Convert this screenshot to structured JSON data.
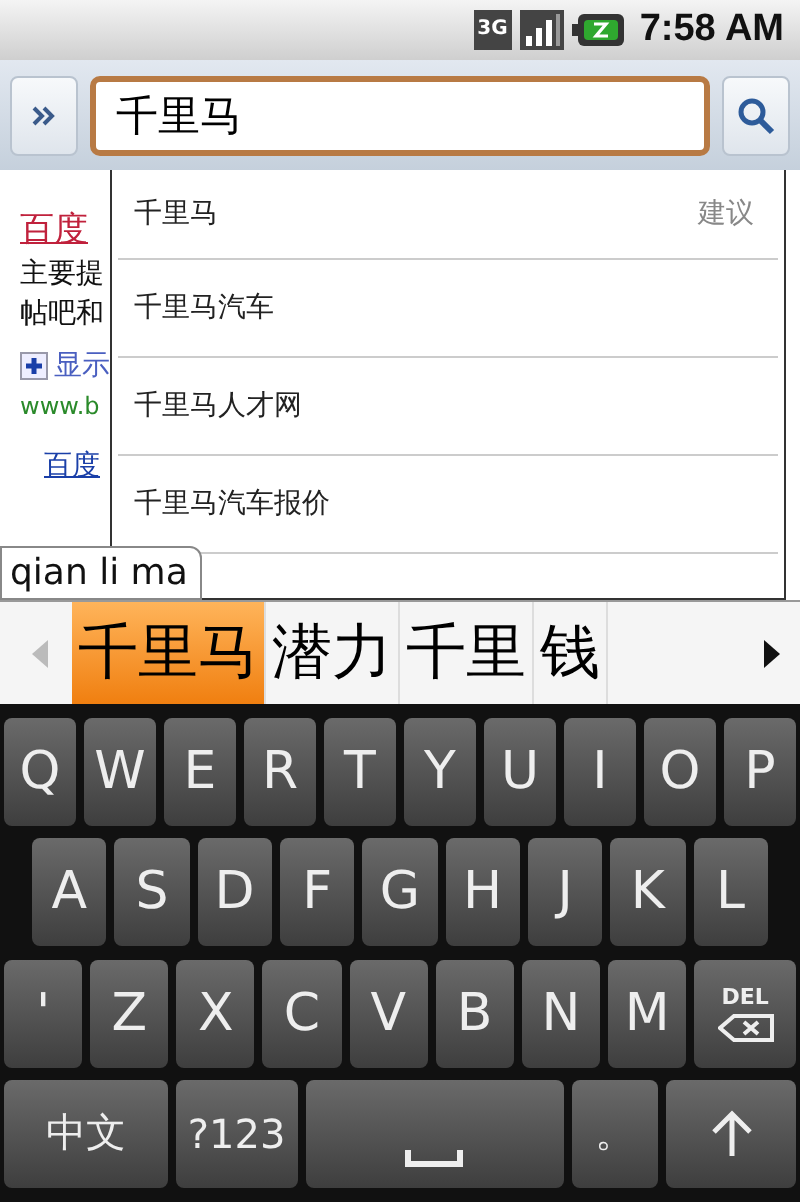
{
  "status_bar": {
    "network": "3G",
    "time": "7:58 AM"
  },
  "toolbar": {
    "query": "千里马"
  },
  "page": {
    "title": "百度",
    "lines": [
      "主要提",
      "帖吧和"
    ],
    "expand_link": "显示",
    "url": "www.b",
    "sub_link": "百度"
  },
  "suggestions": [
    {
      "text": "千里马",
      "tag": "建议"
    },
    {
      "text": "千里马汽车"
    },
    {
      "text": "千里马人才网"
    },
    {
      "text": "千里马汽车报价"
    }
  ],
  "composing": "qian li ma",
  "candidates": [
    {
      "text": "千里马",
      "selected": true
    },
    {
      "text": "潜力",
      "selected": false
    },
    {
      "text": "千里",
      "selected": false
    },
    {
      "text": "钱",
      "selected": false
    }
  ],
  "keyboard": {
    "rows": [
      [
        {
          "kind": "char",
          "label": "Q"
        },
        {
          "kind": "char",
          "label": "W"
        },
        {
          "kind": "char",
          "label": "E"
        },
        {
          "kind": "char",
          "label": "R"
        },
        {
          "kind": "char",
          "label": "T"
        },
        {
          "kind": "char",
          "label": "Y"
        },
        {
          "kind": "char",
          "label": "U"
        },
        {
          "kind": "char",
          "label": "I"
        },
        {
          "kind": "char",
          "label": "O"
        },
        {
          "kind": "char",
          "label": "P"
        }
      ],
      [
        {
          "kind": "char",
          "label": "A"
        },
        {
          "kind": "char",
          "label": "S"
        },
        {
          "kind": "char",
          "label": "D"
        },
        {
          "kind": "char",
          "label": "F"
        },
        {
          "kind": "char",
          "label": "G"
        },
        {
          "kind": "char",
          "label": "H"
        },
        {
          "kind": "char",
          "label": "J"
        },
        {
          "kind": "char",
          "label": "K"
        },
        {
          "kind": "char",
          "label": "L"
        }
      ],
      [
        {
          "kind": "char",
          "label": "'"
        },
        {
          "kind": "char",
          "label": "Z"
        },
        {
          "kind": "char",
          "label": "X"
        },
        {
          "kind": "char",
          "label": "C"
        },
        {
          "kind": "char",
          "label": "V"
        },
        {
          "kind": "char",
          "label": "B"
        },
        {
          "kind": "char",
          "label": "N"
        },
        {
          "kind": "char",
          "label": "M"
        },
        {
          "kind": "delete",
          "label": "DEL"
        }
      ]
    ],
    "function_keys": [
      {
        "kind": "lang",
        "label": "中文"
      },
      {
        "kind": "symbols",
        "label": "?123"
      },
      {
        "kind": "space"
      },
      {
        "kind": "char",
        "label": "。"
      },
      {
        "kind": "enter"
      }
    ]
  }
}
